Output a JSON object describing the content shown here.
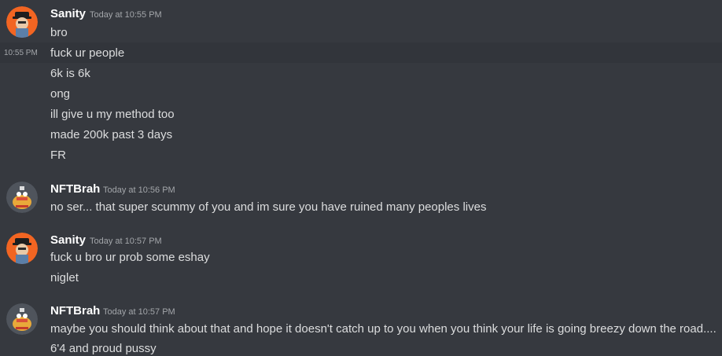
{
  "messages": [
    {
      "author": "Sanity",
      "timestamp": "Today at 10:55 PM",
      "avatar": "sanity-avatar",
      "lines": [
        "bro",
        "fuck ur people",
        "6k is 6k",
        "ong",
        "ill give u my method too",
        "made 200k past 3 days",
        "FR"
      ],
      "hover_time": "10:55 PM"
    },
    {
      "author": "NFTBrah",
      "timestamp": "Today at 10:56 PM",
      "avatar": "nftbrah-avatar",
      "lines": [
        "no ser... that super scummy of you and im sure you have ruined many peoples lives"
      ]
    },
    {
      "author": "Sanity",
      "timestamp": "Today at 10:57 PM",
      "avatar": "sanity-avatar",
      "lines": [
        "fuck u bro ur prob some eshay",
        "niglet"
      ]
    },
    {
      "author": "NFTBrah",
      "timestamp": "Today at 10:57 PM",
      "avatar": "nftbrah-avatar",
      "lines": [
        "maybe you should think about that and hope it doesn't catch up to you when you think your life is going breezy down the road....",
        "6'4 and proud pussy"
      ]
    }
  ],
  "colors": {
    "background": "#36393f",
    "hover_row": "#32353b",
    "username": "#ffffff",
    "text": "#dcddde",
    "timestamp": "#a3a6aa",
    "sanity_avatar_bg": "#f26522",
    "nftbrah_avatar_bg": "#4f545c"
  }
}
